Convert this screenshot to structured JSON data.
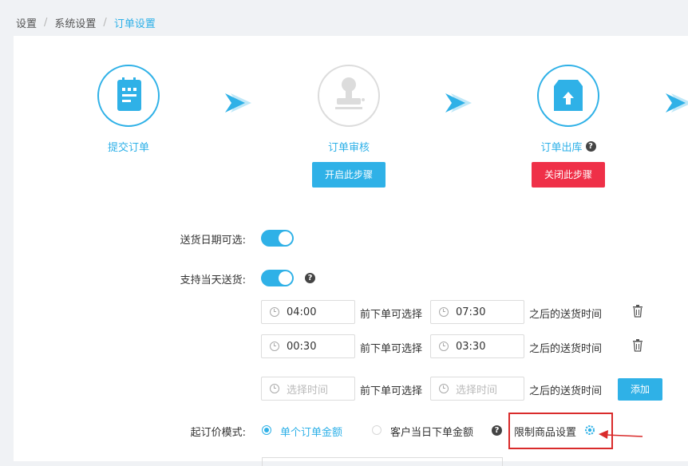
{
  "breadcrumb": {
    "items": [
      "设置",
      "系统设置",
      "订单设置"
    ],
    "separator": "/"
  },
  "steps": [
    {
      "label": "提交订单"
    },
    {
      "label": "订单审核",
      "button": "开启此步骤"
    },
    {
      "label": "订单出库",
      "button": "关闭此步骤"
    }
  ],
  "form": {
    "delivery_date_label": "送货日期可选:",
    "same_day_label": "支持当天送货:",
    "help_mark": "?",
    "time_rows": [
      {
        "before": "04:00",
        "after": "07:30"
      },
      {
        "before": "00:30",
        "after": "03:30"
      }
    ],
    "new_row": {
      "placeholder_before": "选择时间",
      "placeholder_after": "选择时间",
      "add_button": "添加"
    },
    "mid_text": "前下单可选择",
    "end_text": "之后的送货时间",
    "min_order_label": "起订价模式:",
    "mode_options": [
      {
        "label": "单个订单金额",
        "selected": true
      },
      {
        "label": "客户当日下单金额",
        "selected": false
      }
    ],
    "limit_goods_label": "限制商品设置"
  },
  "colors": {
    "accent": "#2fb1e7",
    "danger": "#ef3048",
    "highlight": "#d92b2b"
  }
}
